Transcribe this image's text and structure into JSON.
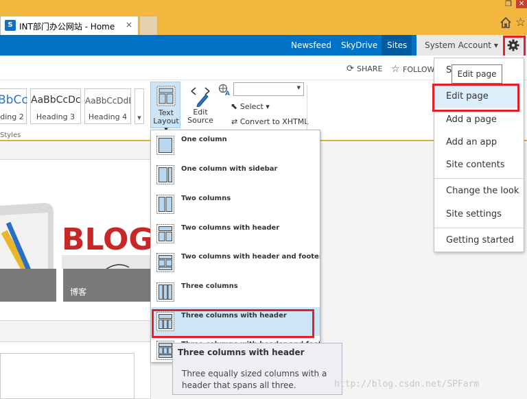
{
  "browser": {
    "tab_favicon": "S",
    "tab_title": "INT部门办公网站 - Home",
    "tab_close": "×",
    "restore_glyph": "❐",
    "close_glyph": "×",
    "star_glyph": "☆"
  },
  "suite_bar": {
    "links": [
      "Newsfeed",
      "SkyDrive",
      "Sites"
    ],
    "account": "System Account ▾",
    "accent": "#0072c6"
  },
  "promoted": {
    "share": "SHARE",
    "follow": "FOLLOW"
  },
  "ribbon": {
    "styles": [
      {
        "sample": "BbCc",
        "name": "ding 2"
      },
      {
        "sample": "AaBbCcDc",
        "name": "Heading 3"
      },
      {
        "sample": "AaBbCcDdE",
        "name": "Heading 4"
      }
    ],
    "styles_group": "Styles",
    "text_layout": "Text\nLayout ▾",
    "edit_source": "Edit\nSource",
    "select": "Select ▾",
    "convert": "Convert to XHTML"
  },
  "tile": {
    "caption": "博客",
    "image_text": "BLOG"
  },
  "layout_menu": {
    "items": [
      "One column",
      "One column with sidebar",
      "Two columns",
      "Two columns with header",
      "Two columns with header and footer",
      "Three columns",
      "Three columns with header",
      "Three columns with header and footer"
    ],
    "selected": "Three columns with header"
  },
  "tooltip": {
    "title": "Three columns with header",
    "description": "Three equally sized columns with a header that spans all three."
  },
  "settings_menu": {
    "partial_first": "S",
    "items": [
      "Edit page",
      "Add a page",
      "Add an app",
      "Site contents",
      "Change the look",
      "Site settings",
      "Getting started"
    ],
    "hover_tooltip": "Edit page"
  },
  "watermark": "http://blog.csdn.net/SPFarm",
  "colors": {
    "highlight_red": "#e0202a",
    "chrome_orange": "#f3b63f"
  }
}
